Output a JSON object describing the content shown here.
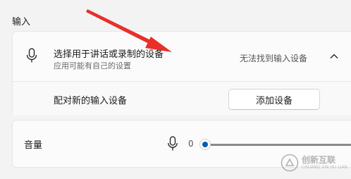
{
  "section": {
    "title": "输入"
  },
  "input_device": {
    "title": "选择用于讲话或录制的设备",
    "subtitle": "应用可能有自己的设置",
    "status": "无法找到输入设备",
    "mic_icon": "microphone-icon",
    "chevron_icon": "chevron-up-icon"
  },
  "pair": {
    "label": "配对新的输入设备",
    "button_label": "添加设备"
  },
  "volume": {
    "label": "音量",
    "value": "0",
    "level": 0,
    "mic_icon": "microphone-icon"
  },
  "annotation": {
    "color": "#e8302a"
  },
  "watermark": {
    "cn": "创新互联",
    "en": "CHUANG XIN HU LIAN"
  }
}
